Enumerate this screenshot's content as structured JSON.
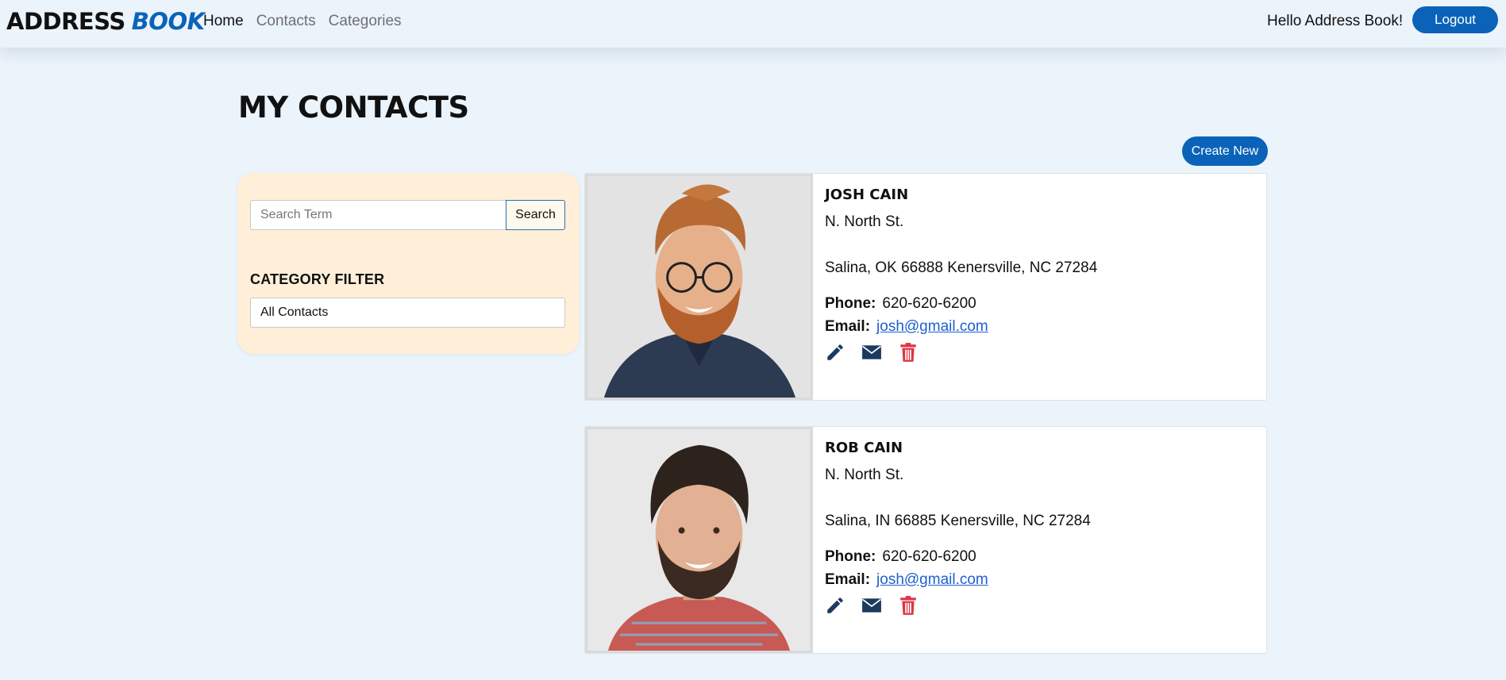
{
  "navbar": {
    "brand_part1": "ADDRESS",
    "brand_part2": "BOOK",
    "links": [
      {
        "label": "Home",
        "active": true
      },
      {
        "label": "Contacts",
        "active": false
      },
      {
        "label": "Categories",
        "active": false
      }
    ],
    "greeting": "Hello Address Book!",
    "logout_label": "Logout"
  },
  "page": {
    "title": "MY CONTACTS",
    "create_label": "Create New"
  },
  "filter": {
    "search_placeholder": "Search Term",
    "search_label": "Search",
    "category_heading": "CATEGORY FILTER",
    "category_selected": "All Contacts"
  },
  "contacts": [
    {
      "name": "JOSH CAIN",
      "street": "N. North St.",
      "city_line": "Salina, OK 66888 Kenersville, NC 27284",
      "phone_label": "Phone:",
      "phone": "620-620-6200",
      "email_label": "Email:",
      "email": "josh@gmail.com"
    },
    {
      "name": "ROB CAIN",
      "street": "N. North St.",
      "city_line": "Salina, IN 66885 Kenersville, NC 27284",
      "phone_label": "Phone:",
      "phone": "620-620-6200",
      "email_label": "Email:",
      "email": "josh@gmail.com"
    }
  ],
  "icons": {
    "edit": "pencil-icon",
    "email": "envelope-icon",
    "delete": "trash-icon"
  },
  "colors": {
    "accent": "#0a63b8",
    "background": "#ebf3fb",
    "filter_panel": "#ffefd9",
    "icon_dark": "#1c3a5e",
    "icon_delete": "#dc3545",
    "link": "#1f5fd0"
  }
}
